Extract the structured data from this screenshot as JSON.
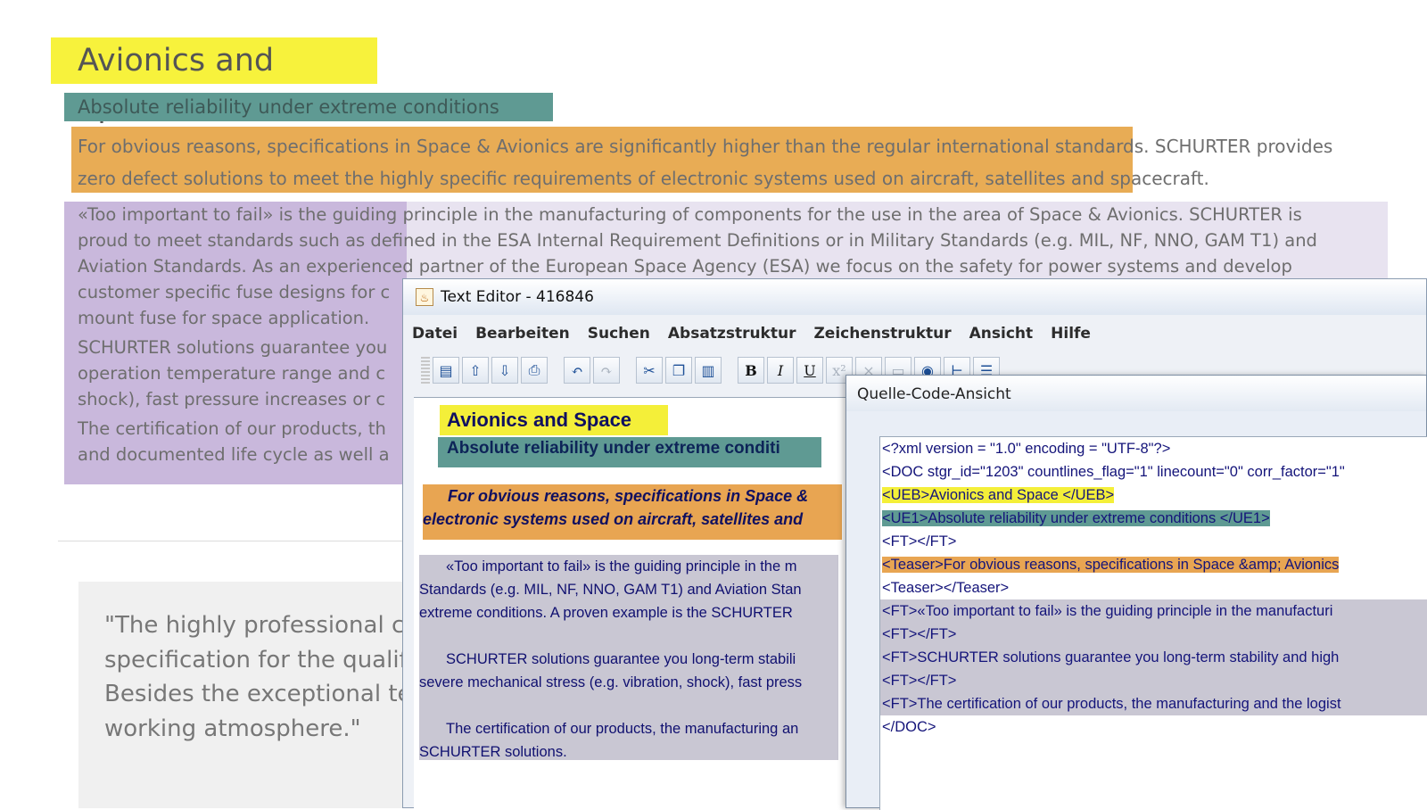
{
  "web": {
    "heading": "Avionics and Space",
    "subheading": "Absolute reliability under extreme conditions",
    "teaser_lines": [
      "For obvious reasons, specifications in Space & Avionics are significantly higher than the regular international standards. SCHURTER provides",
      "zero defect solutions to meet the highly specific requirements of electronic systems used on aircraft, satellites and spacecraft."
    ],
    "paragraph1_lines": [
      "«Too important to fail» is the guiding principle in the manufacturing of components for the use in the area of Space & Avionics. SCHURTER is",
      "proud to meet standards such as defined in the ESA Internal Requirement Definitions or in Military Standards (e.g. MIL, NF, NNO, GAM T1) and",
      "Aviation Standards. As an experienced partner of the European Space Agency (ESA) we focus on the safety for power systems and develop",
      "customer specific fuse designs for c",
      "mount fuse for space application."
    ],
    "paragraph2_lines": [
      "SCHURTER solutions guarantee you",
      "operation temperature range and c",
      "shock), fast pressure increases or c"
    ],
    "paragraph3_lines": [
      "The certification of our products, th",
      "and documented life cycle as well a"
    ],
    "quote_lines": [
      "\"The highly professional co",
      "specification for the qualifi",
      "Besides the exceptional tec",
      "working atmosphere.\""
    ]
  },
  "editor": {
    "title": "Text Editor - 416846",
    "menu": [
      "Datei",
      "Bearbeiten",
      "Suchen",
      "Absatzstruktur",
      "Zeichenstruktur",
      "Ansicht",
      "Hilfe"
    ],
    "doc": {
      "heading": "Avionics and Space",
      "subheading": "Absolute reliability under extreme conditi",
      "teaser_lines": [
        "For obvious reasons, specifications in Space &",
        "electronic systems used on aircraft, satellites and"
      ],
      "ft1_lines": [
        "«Too important to fail» is the guiding principle in the m",
        "Standards (e.g. MIL, NF, NNO, GAM T1) and Aviation Stan",
        "extreme conditions. A proven example is the SCHURTER"
      ],
      "ft2_lines": [
        "SCHURTER solutions guarantee you long-term stabili",
        "severe mechanical stress (e.g. vibration, shock), fast press"
      ],
      "ft3_lines": [
        "The certification of our products, the manufacturing an",
        "SCHURTER solutions."
      ]
    }
  },
  "source_view": {
    "title": "Quelle-Code-Ansicht",
    "lines": [
      "<?xml version = \"1.0\" encoding = \"UTF-8\"?>",
      "<DOC stgr_id=\"1203\" countlines_flag=\"1\" linecount=\"0\" corr_factor=\"1\"",
      "<UEB>Avionics and Space    </UEB>",
      "<UE1>Absolute reliability under extreme conditions </UE1>",
      "<FT></FT>",
      "<Teaser>For obvious reasons, specifications in Space &amp; Avionics",
      "<Teaser></Teaser>",
      "<FT>«Too important to fail» is the guiding principle in the manufacturi",
      "<FT></FT>",
      "<FT>SCHURTER solutions guarantee you long-term stability and high",
      "<FT></FT>",
      "<FT>The certification of our products, the manufacturing and the logist",
      "</DOC>"
    ]
  },
  "colors": {
    "heading_highlight": "#f4ef39",
    "subheading_highlight": "#5f9a93",
    "teaser_highlight": "#e8a552",
    "body_highlight": "#c9b8dc"
  }
}
